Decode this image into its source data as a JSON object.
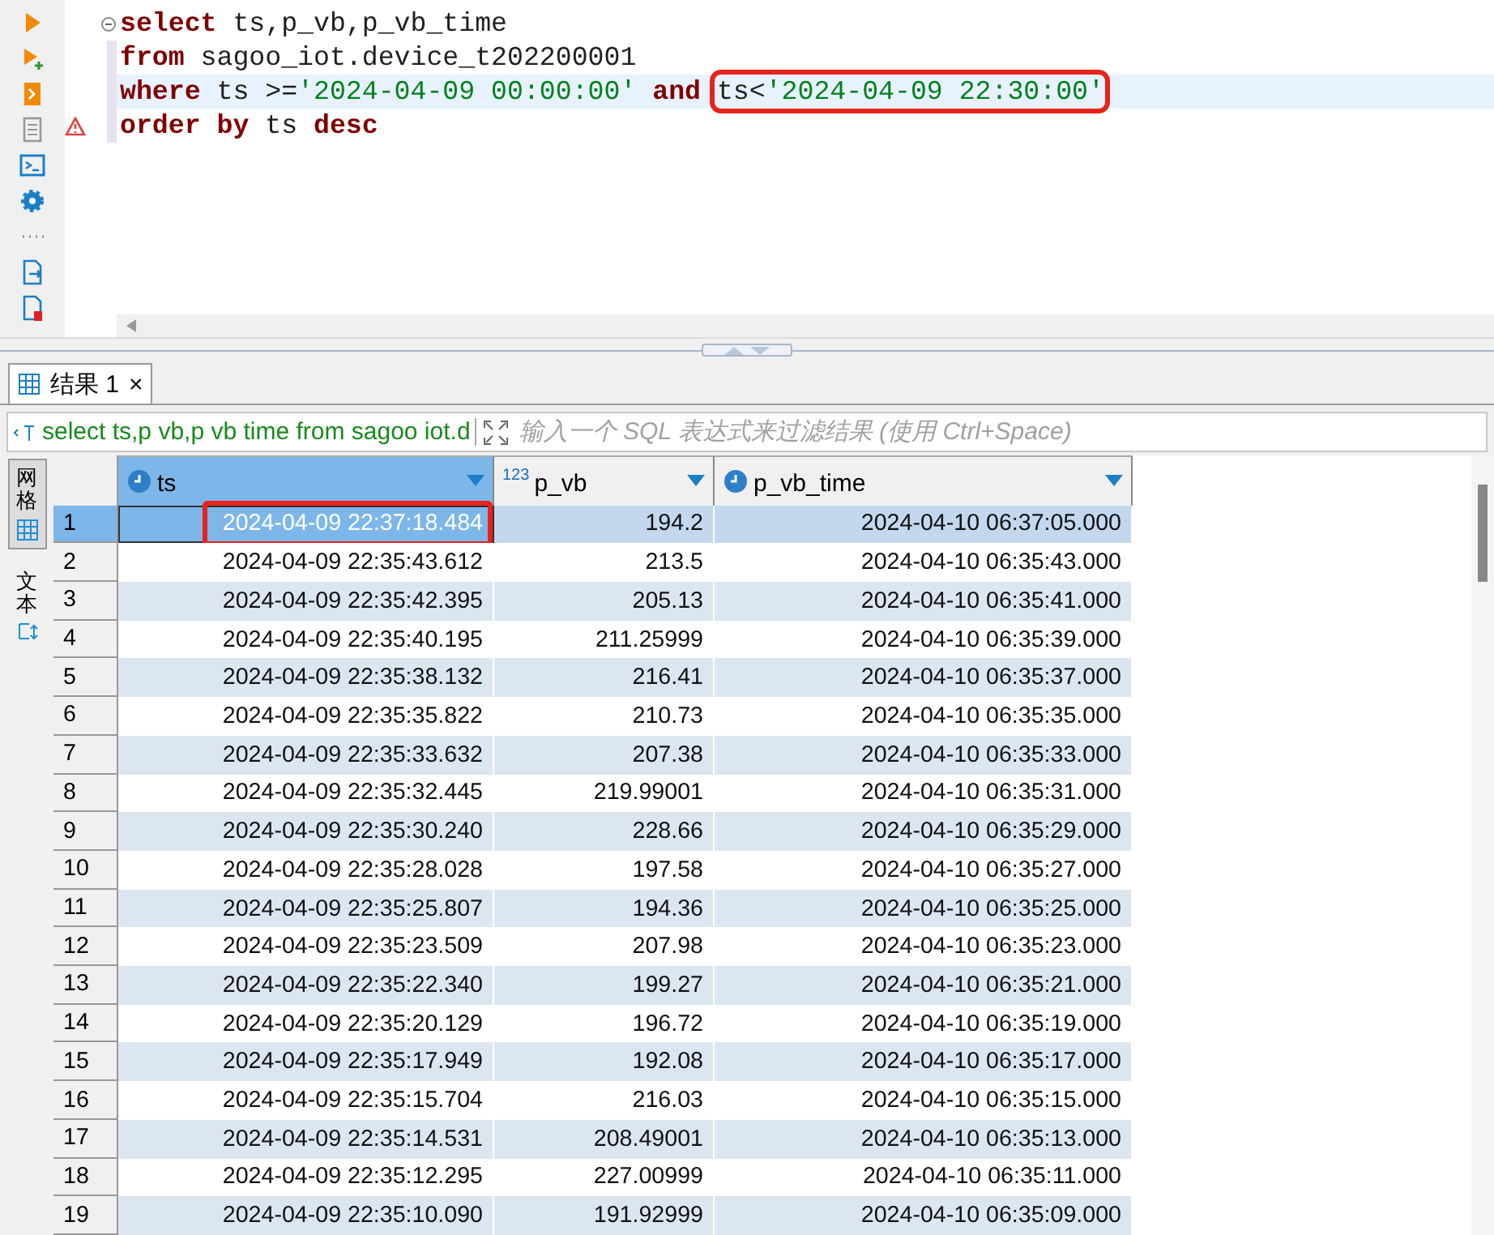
{
  "editor": {
    "lines": [
      {
        "tokens": [
          {
            "kind": "keyword",
            "text": "select"
          },
          {
            "kind": "plain",
            "text": " ts,p_vb,p_vb_time"
          }
        ],
        "current": false,
        "marker": {
          "kind": "fold"
        }
      },
      {
        "tokens": [
          {
            "kind": "keyword",
            "text": "from"
          },
          {
            "kind": "plain",
            "text": " sagoo_iot.device_t202200001"
          }
        ],
        "current": false
      },
      {
        "tokens": [
          {
            "kind": "keyword",
            "text": "where"
          },
          {
            "kind": "plain",
            "text": " ts >="
          },
          {
            "kind": "string",
            "text": "'2024-04-09 00:00:00'"
          },
          {
            "kind": "keyword",
            "text": " and "
          },
          {
            "kind": "framed",
            "tokens": [
              {
                "kind": "plain",
                "text": "ts<"
              },
              {
                "kind": "string",
                "text": "'2024-04-09 22:30:00'"
              }
            ]
          }
        ],
        "current": true
      },
      {
        "tokens": [
          {
            "kind": "keyword",
            "text": "order by"
          },
          {
            "kind": "plain",
            "text": " ts "
          },
          {
            "kind": "keyword",
            "text": "desc"
          }
        ],
        "current": false,
        "marker": {
          "kind": "warning"
        }
      }
    ]
  },
  "result_tab": {
    "label": "结果 1",
    "close": "×"
  },
  "filter": {
    "query": "select ts,p vb,p vb time from sagoo iot.d",
    "placeholder": "输入一个 SQL 表达式来过滤结果 (使用 Ctrl+Space)"
  },
  "side_tabs": [
    {
      "label": "网格",
      "selected": true
    },
    {
      "label": "文本",
      "selected": false
    }
  ],
  "table": {
    "columns": [
      {
        "label": "ts",
        "kind": "timestamp",
        "selected": true
      },
      {
        "label": "p_vb",
        "kind": "number",
        "type_label": "123",
        "selected": false
      },
      {
        "label": "p_vb_time",
        "kind": "time",
        "selected": false
      }
    ],
    "rows": [
      {
        "num": "1",
        "cells": [
          "2024-04-09 22:37:18.484",
          "194.2",
          "2024-04-10 06:37:05.000"
        ],
        "selected": true,
        "framed": true
      },
      {
        "num": "2",
        "cells": [
          "2024-04-09 22:35:43.612",
          "213.5",
          "2024-04-10 06:35:43.000"
        ],
        "selected": false,
        "framed": false
      },
      {
        "num": "3",
        "cells": [
          "2024-04-09 22:35:42.395",
          "205.13",
          "2024-04-10 06:35:41.000"
        ],
        "selected": false,
        "framed": false
      },
      {
        "num": "4",
        "cells": [
          "2024-04-09 22:35:40.195",
          "211.25999",
          "2024-04-10 06:35:39.000"
        ],
        "selected": false,
        "framed": false
      },
      {
        "num": "5",
        "cells": [
          "2024-04-09 22:35:38.132",
          "216.41",
          "2024-04-10 06:35:37.000"
        ],
        "selected": false,
        "framed": false
      },
      {
        "num": "6",
        "cells": [
          "2024-04-09 22:35:35.822",
          "210.73",
          "2024-04-10 06:35:35.000"
        ],
        "selected": false,
        "framed": false
      },
      {
        "num": "7",
        "cells": [
          "2024-04-09 22:35:33.632",
          "207.38",
          "2024-04-10 06:35:33.000"
        ],
        "selected": false,
        "framed": false
      },
      {
        "num": "8",
        "cells": [
          "2024-04-09 22:35:32.445",
          "219.99001",
          "2024-04-10 06:35:31.000"
        ],
        "selected": false,
        "framed": false
      },
      {
        "num": "9",
        "cells": [
          "2024-04-09 22:35:30.240",
          "228.66",
          "2024-04-10 06:35:29.000"
        ],
        "selected": false,
        "framed": false
      },
      {
        "num": "10",
        "cells": [
          "2024-04-09 22:35:28.028",
          "197.58",
          "2024-04-10 06:35:27.000"
        ],
        "selected": false,
        "framed": false
      },
      {
        "num": "11",
        "cells": [
          "2024-04-09 22:35:25.807",
          "194.36",
          "2024-04-10 06:35:25.000"
        ],
        "selected": false,
        "framed": false
      },
      {
        "num": "12",
        "cells": [
          "2024-04-09 22:35:23.509",
          "207.98",
          "2024-04-10 06:35:23.000"
        ],
        "selected": false,
        "framed": false
      },
      {
        "num": "13",
        "cells": [
          "2024-04-09 22:35:22.340",
          "199.27",
          "2024-04-10 06:35:21.000"
        ],
        "selected": false,
        "framed": false
      },
      {
        "num": "14",
        "cells": [
          "2024-04-09 22:35:20.129",
          "196.72",
          "2024-04-10 06:35:19.000"
        ],
        "selected": false,
        "framed": false
      },
      {
        "num": "15",
        "cells": [
          "2024-04-09 22:35:17.949",
          "192.08",
          "2024-04-10 06:35:17.000"
        ],
        "selected": false,
        "framed": false
      },
      {
        "num": "16",
        "cells": [
          "2024-04-09 22:35:15.704",
          "216.03",
          "2024-04-10 06:35:15.000"
        ],
        "selected": false,
        "framed": false
      },
      {
        "num": "17",
        "cells": [
          "2024-04-09 22:35:14.531",
          "208.49001",
          "2024-04-10 06:35:13.000"
        ],
        "selected": false,
        "framed": false
      },
      {
        "num": "18",
        "cells": [
          "2024-04-09 22:35:12.295",
          "227.00999",
          "2024-04-10 06:35:11.000"
        ],
        "selected": false,
        "framed": false
      },
      {
        "num": "19",
        "cells": [
          "2024-04-09 22:35:10.090",
          "191.92999",
          "2024-04-10 06:35:09.000"
        ],
        "selected": false,
        "framed": false
      }
    ]
  }
}
